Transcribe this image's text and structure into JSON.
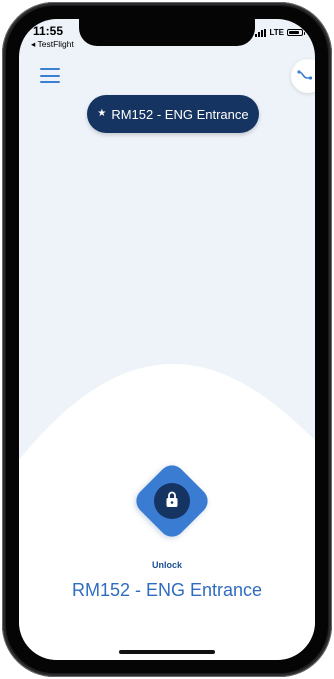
{
  "status_bar": {
    "time": "11:55",
    "back_app": "◂ TestFlight",
    "network": "LTE"
  },
  "header": {
    "menu_icon": "hamburger-menu-icon",
    "map_icon": "route-icon"
  },
  "selected_door": {
    "label": "RM152 - ENG Entrance",
    "star": "★"
  },
  "unlock": {
    "label": "Unlock",
    "icon": "lock-icon",
    "door_name": "RM152 - ENG Entrance"
  },
  "colors": {
    "accent": "#3a7cd2",
    "navy": "#163461",
    "background": "#edf3f9"
  }
}
